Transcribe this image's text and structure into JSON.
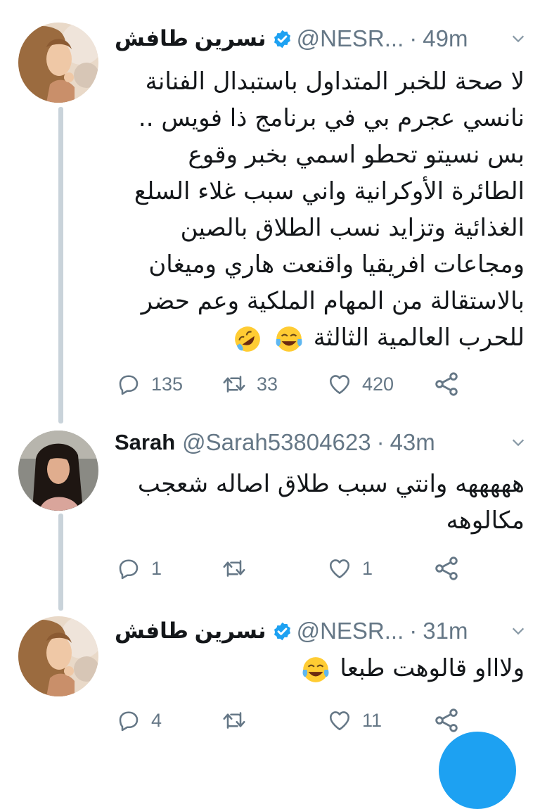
{
  "tweets": [
    {
      "name": "نسرين طافش",
      "verified": true,
      "handle": "@NESR...",
      "time": "49m",
      "lines": [
        "لا صحة للخبر المتداول باستبدال الفنانة",
        "نانسي عجرم بي في برنامج ذا فويس ..",
        "بس نسيتو تحطو اسمي بخبر وقوع",
        "الطائرة الأوكرانية واني سبب غلاء السلع",
        "الغذائية وتزايد نسب الطلاق بالصين",
        "ومجاعات افريقيا واقنعت هاري وميغان",
        "بالاستقالة من المهام الملكية وعم حضر",
        "للحرب العالمية الثالثة"
      ],
      "emojis": [
        "rolling-on-floor-laughing",
        "tears-of-joy"
      ],
      "replies": "135",
      "retweets": "33",
      "likes": "420"
    },
    {
      "name": "Sarah",
      "verified": false,
      "handle": "@Sarah53804623",
      "time": "43m",
      "lines": [
        "هههههه وانتي سبب طلاق اصاله شعجب",
        "مكالوهه"
      ],
      "emojis": [],
      "replies": "1",
      "retweets": "",
      "likes": "1"
    },
    {
      "name": "نسرين طافش",
      "verified": true,
      "handle": "@NESR...",
      "time": "31m",
      "lines": [
        "ولاااو قالوهت طبعا"
      ],
      "emojis": [
        "tears-of-joy"
      ],
      "replies": "4",
      "retweets": "",
      "likes": "11"
    }
  ],
  "separator": "·",
  "colors": {
    "text": "#14171a",
    "muted": "#657786",
    "verified": "#1da1f2",
    "thread": "#c9d3da",
    "fab": "#1da1f2"
  }
}
